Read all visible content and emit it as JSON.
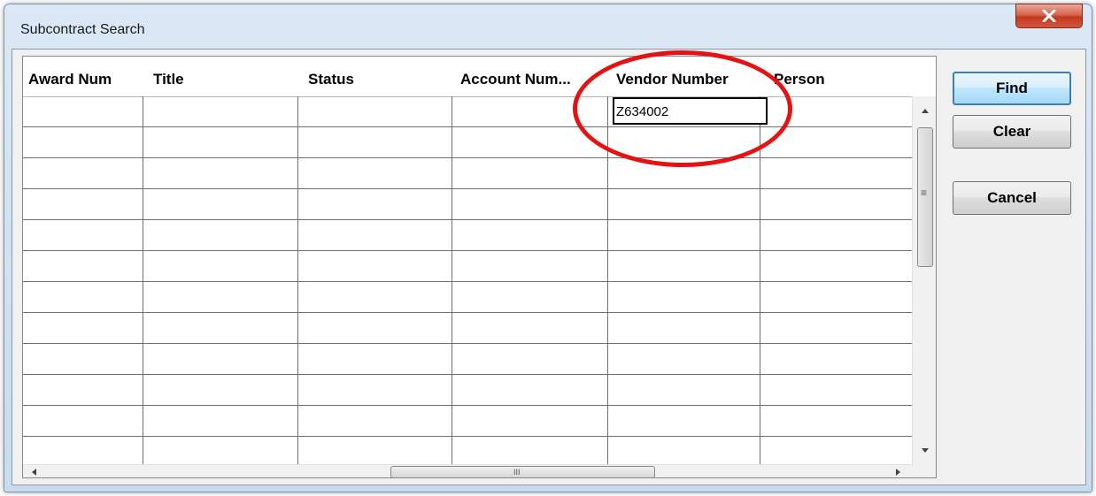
{
  "window": {
    "title": "Subcontract Search"
  },
  "grid": {
    "columns": [
      {
        "label": "Award Num"
      },
      {
        "label": "Title"
      },
      {
        "label": "Status"
      },
      {
        "label": "Account Num..."
      },
      {
        "label": "Vendor Number"
      },
      {
        "label": "Person"
      }
    ],
    "editing_cell_value": "Z634002",
    "scroll_grip": "≡",
    "hscroll_grip": "III"
  },
  "buttons": {
    "find": "Find",
    "clear": "Clear",
    "cancel": "Cancel"
  },
  "colors": {
    "annotation": "#e41212",
    "close_button": "#c2391f",
    "default_button_border": "#3c7fb1"
  }
}
